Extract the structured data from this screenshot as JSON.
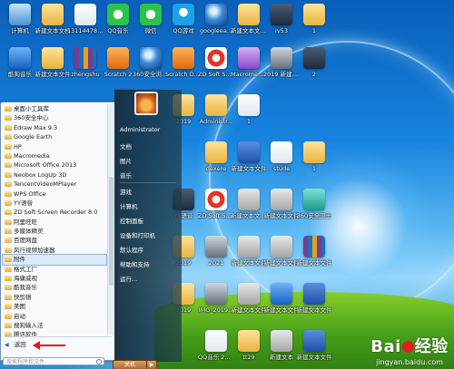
{
  "desktop": {
    "icons_row1": [
      {
        "label": "计算机",
        "icon": "computer-icon"
      },
      {
        "label": "新建文本文档",
        "icon": "text-document-icon"
      },
      {
        "label": "1311447826",
        "icon": "document-icon"
      },
      {
        "label": "QQ音乐",
        "icon": "qq-music-icon"
      },
      {
        "label": "微信",
        "icon": "wechat-icon"
      },
      {
        "label": "QQ游戏",
        "icon": "qq-game-icon"
      },
      {
        "label": "googleea...",
        "icon": "google-earth-icon"
      },
      {
        "label": "新建文本文件 (3)",
        "icon": "text-document-icon"
      },
      {
        "label": "iv53",
        "icon": "app-icon"
      },
      {
        "label": "1",
        "icon": "folder-icon"
      }
    ],
    "icons_row2": [
      {
        "label": "酷狗音乐",
        "icon": "kugou-icon"
      },
      {
        "label": "新建文本文件",
        "icon": "text-document-icon"
      },
      {
        "label": "zhengshu",
        "icon": "winrar-icon"
      },
      {
        "label": "Scratch 2",
        "icon": "scratch-icon"
      },
      {
        "label": "360安全浏览器",
        "icon": "360-browser-icon"
      },
      {
        "label": "Scratch Desktop",
        "icon": "scratch-desktop-icon"
      },
      {
        "label": "ZD Soft Screen...",
        "icon": "recorder-icon"
      },
      {
        "label": "Macromedi... Authorwa...",
        "icon": "macromedia-icon"
      },
      {
        "label": "2019 新建文本文件",
        "icon": "image-icon"
      },
      {
        "label": "2",
        "icon": "app-icon"
      }
    ],
    "other_icons": [
      {
        "label": "2019",
        "icon": "folder-icon"
      },
      {
        "label": "Administr...",
        "icon": "folder-icon"
      },
      {
        "label": "1",
        "icon": "document-icon"
      },
      {
        "label": "dexere",
        "icon": "folder-icon"
      },
      {
        "label": "新建文本文件",
        "icon": "word-icon"
      },
      {
        "label": "stude",
        "icon": "document-icon"
      },
      {
        "label": "1",
        "icon": "folder-icon"
      },
      {
        "label": "YY语音",
        "icon": "yy-icon"
      },
      {
        "label": "ZD Soft Screen...",
        "icon": "recorder-icon"
      },
      {
        "label": "新建文本文件 (2)",
        "icon": "text-document-icon"
      },
      {
        "label": "新建文本文件",
        "icon": "text-document-icon"
      },
      {
        "label": "360安全卫士",
        "icon": "360-icon"
      },
      {
        "label": "2019",
        "icon": "folder-icon"
      },
      {
        "label": "2021",
        "icon": "image-icon"
      },
      {
        "label": "新建文本文件",
        "icon": "text-document-icon"
      },
      {
        "label": "新建文本文件",
        "icon": "text-document-icon"
      },
      {
        "label": "新建文本文件",
        "icon": "winrar-icon"
      },
      {
        "label": "2019",
        "icon": "folder-icon"
      },
      {
        "label": "IMG_2019...",
        "icon": "image-icon"
      },
      {
        "label": "新建文本文件",
        "icon": "text-document-icon"
      },
      {
        "label": "新建文本文件",
        "icon": "app-icon"
      },
      {
        "label": "新建文本文件",
        "icon": "word-icon"
      },
      {
        "label": "QQ音乐 20191102",
        "icon": "document-icon"
      },
      {
        "label": "tt29",
        "icon": "folder-icon"
      },
      {
        "label": "新建文本",
        "icon": "text-document-icon"
      },
      {
        "label": "新建文本文件",
        "icon": "word-icon"
      }
    ]
  },
  "start_menu": {
    "programs": [
      "桌面小工具库",
      "360安全中心",
      "Edraw Max 9.3",
      "Google Earth",
      "HP",
      "Macromedia",
      "Microsoft Office 2013",
      "Neobox LogUp 3D",
      "TencentVideoMPlayer",
      "WPS Office",
      "YY语音",
      "ZD Soft Screen Recorder 8.0",
      "阿里旺旺",
      "多媒体精灵",
      "百度网盘",
      "风行视频加速器",
      "附件",
      "格式工厂",
      "海康威视",
      "酷我音乐",
      "快剪辑",
      "美图",
      "启动",
      "搜狗输入法",
      "腾讯软件"
    ],
    "selected_index": 16,
    "back_label": "返回",
    "search_placeholder": "搜索程序和文件",
    "user_name": "Administrator",
    "right_items": [
      "文档",
      "图片",
      "音乐",
      "游戏",
      "计算机",
      "控制面板",
      "设备和打印机",
      "默认程序",
      "帮助和支持",
      "运行..."
    ],
    "shutdown_label": "关机"
  },
  "watermark": {
    "logo": "Bai 百度",
    "brand_a": "Bai",
    "brand_b": "经验",
    "url": "jingyan.baidu.com"
  }
}
